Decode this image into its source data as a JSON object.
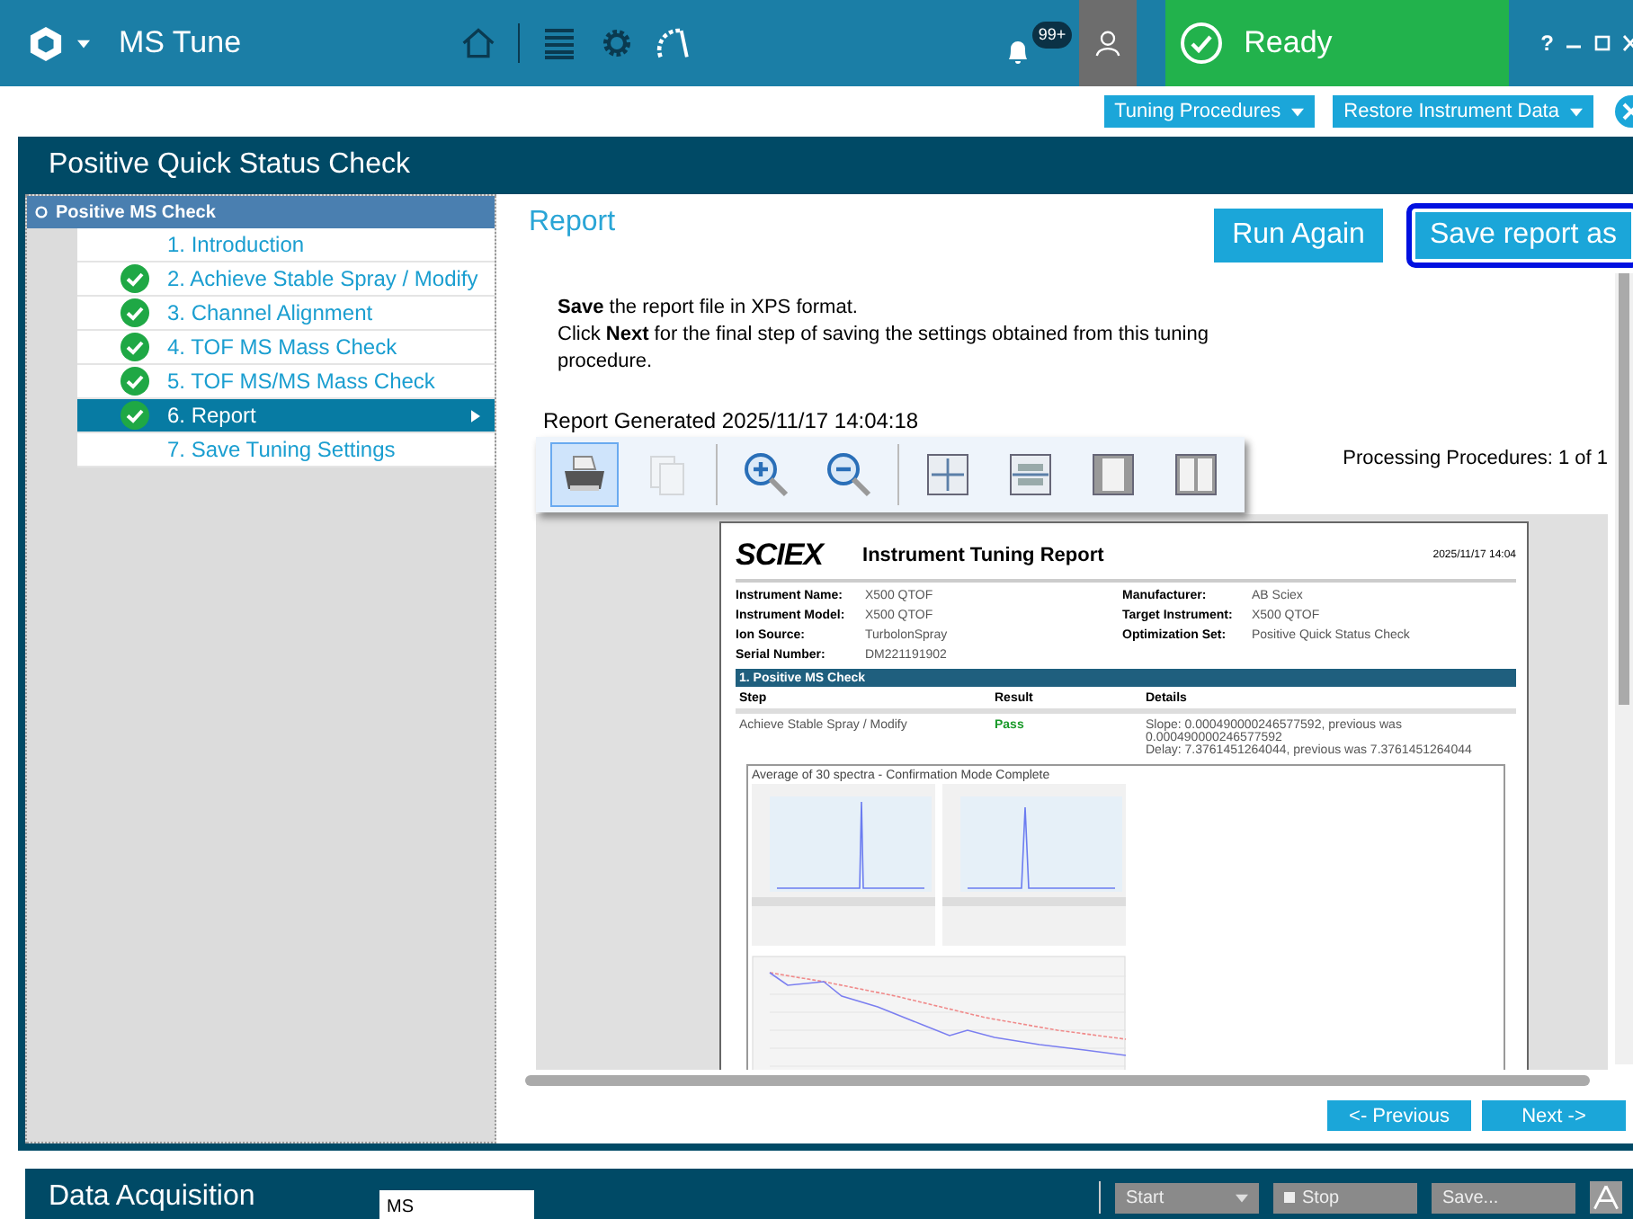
{
  "app": {
    "title": "MS Tune"
  },
  "notifications": {
    "badge": "99+"
  },
  "status": {
    "text": "Ready"
  },
  "window_controls": {
    "help": "?"
  },
  "toolbar_buttons": [
    "Tuning Procedures",
    "Restore Instrument Data"
  ],
  "panel": {
    "title": "Positive Quick Status Check"
  },
  "steps": {
    "header": "Positive MS Check",
    "items": [
      {
        "label": "1. Introduction",
        "done": false,
        "selected": false
      },
      {
        "label": "2. Achieve Stable Spray / Modify",
        "done": true,
        "selected": false
      },
      {
        "label": "3. Channel Alignment",
        "done": true,
        "selected": false
      },
      {
        "label": "4. TOF MS Mass Check",
        "done": true,
        "selected": false
      },
      {
        "label": "5. TOF MS/MS Mass Check",
        "done": true,
        "selected": false
      },
      {
        "label": "6. Report",
        "done": true,
        "selected": true
      },
      {
        "label": "7. Save Tuning Settings",
        "done": false,
        "selected": false
      }
    ]
  },
  "content": {
    "title": "Report",
    "buttons": [
      {
        "label": "Run Again",
        "focused": false
      },
      {
        "label": "Save report as",
        "focused": true
      }
    ],
    "instructions": [
      "**Save** the report file in XPS format.",
      "Click **Next** for the final step of saving the settings obtained from this tuning procedure."
    ],
    "generated": "Report Generated 2025/11/17 14:04:18",
    "processing": "Processing Procedures:  1  of  1",
    "viewer_tools": [
      {
        "kind": "print",
        "selected": true,
        "disabled": false
      },
      {
        "kind": "copy",
        "selected": false,
        "disabled": true
      },
      {
        "kind": "zoom-in",
        "selected": false,
        "disabled": false
      },
      {
        "kind": "zoom-out",
        "selected": false,
        "disabled": false
      },
      {
        "kind": "fit-page",
        "selected": false,
        "disabled": false
      },
      {
        "kind": "fit-width",
        "selected": false,
        "disabled": false
      },
      {
        "kind": "one-page",
        "selected": false,
        "disabled": false
      },
      {
        "kind": "two-pages",
        "selected": false,
        "disabled": false
      }
    ]
  },
  "report": {
    "logo": "SCIEX",
    "title": "Instrument Tuning Report",
    "date": "2025/11/17 14:04",
    "left_fields": [
      {
        "label": "Instrument Name:",
        "value": "X500 QTOF"
      },
      {
        "label": "Instrument Model:",
        "value": "X500 QTOF"
      },
      {
        "label": "Ion Source:",
        "value": "TurbolonSpray"
      },
      {
        "label": "Serial Number:",
        "value": "DM221191902"
      }
    ],
    "right_fields": [
      {
        "label": "Manufacturer:",
        "value": "AB Sciex"
      },
      {
        "label": "Target Instrument:",
        "value": "X500 QTOF"
      },
      {
        "label": "Optimization Set:",
        "value": "Positive Quick Status Check"
      }
    ],
    "section": "1. Positive MS Check",
    "columns": [
      "Step",
      "Result",
      "Details"
    ],
    "rows": [
      {
        "step": "Achieve Stable Spray / Modify",
        "result": "Pass",
        "details": [
          "Slope: 0.000490000246577592, previous was 0.000490000246577592",
          "Delay: 7.3761451264044, previous was 7.3761451264044"
        ]
      }
    ],
    "figure_caption": "Average of 30 spectra - Confirmation Mode Complete"
  },
  "nav": [
    "<- Previous",
    "Next ->"
  ],
  "acquisition": {
    "title": "Data Acquisition",
    "mode": "MS",
    "start": "Start",
    "stop": "Stop",
    "save": "Save..."
  }
}
